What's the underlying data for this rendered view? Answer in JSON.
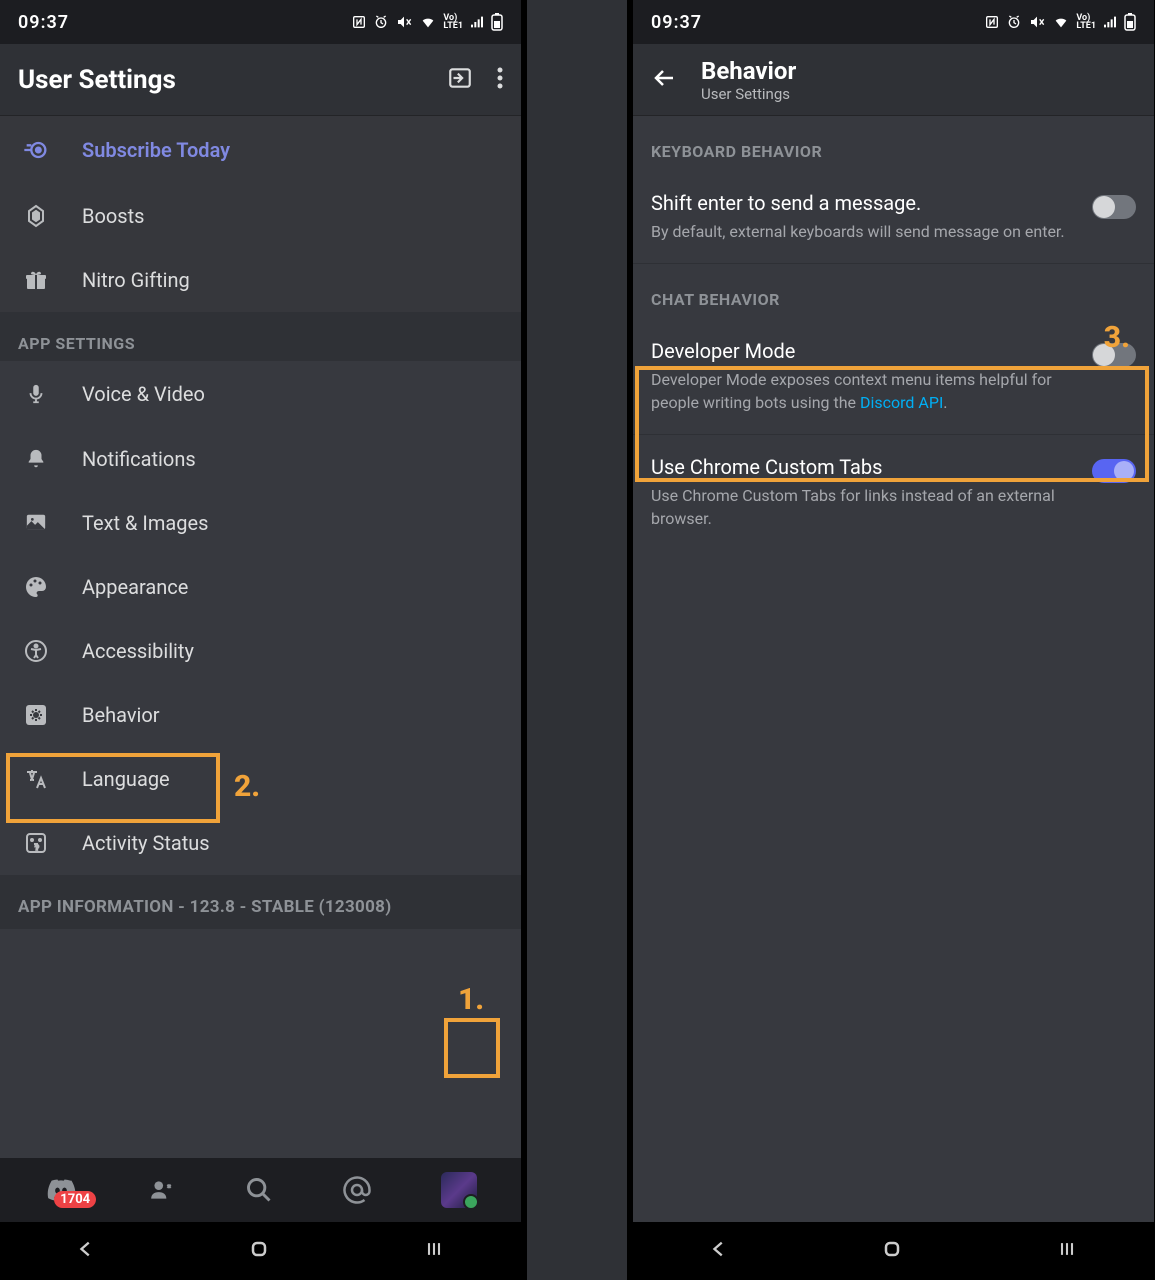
{
  "statusbar": {
    "time": "09:37"
  },
  "left": {
    "header": {
      "title": "User Settings"
    },
    "nitro": {
      "subscribe": "Subscribe Today",
      "boosts": "Boosts",
      "gifting": "Nitro Gifting"
    },
    "sections": {
      "app_settings": "APP SETTINGS",
      "app_info": "APP INFORMATION - 123.8 - STABLE (123008)"
    },
    "app_settings": {
      "voice": "Voice & Video",
      "notifications": "Notifications",
      "text_images": "Text & Images",
      "appearance": "Appearance",
      "accessibility": "Accessibility",
      "behavior": "Behavior",
      "language": "Language",
      "activity_status": "Activity Status"
    },
    "nav": {
      "badge": "1704"
    },
    "annotations": {
      "one": "1.",
      "two": "2."
    }
  },
  "right": {
    "header": {
      "title": "Behavior",
      "subtitle": "User Settings"
    },
    "sections": {
      "keyboard": "KEYBOARD BEHAVIOR",
      "chat": "CHAT BEHAVIOR"
    },
    "keyboard": {
      "shift_enter_title": "Shift enter to send a message.",
      "shift_enter_desc": "By default, external keyboards will send message on enter."
    },
    "chat": {
      "dev_title": "Developer Mode",
      "dev_desc_pre": "Developer Mode exposes context menu items helpful for people writing bots using the ",
      "dev_desc_link": "Discord API",
      "dev_desc_post": ".",
      "chrome_title": "Use Chrome Custom Tabs",
      "chrome_desc": "Use Chrome Custom Tabs for links instead of an external browser."
    },
    "annotations": {
      "three": "3."
    }
  }
}
